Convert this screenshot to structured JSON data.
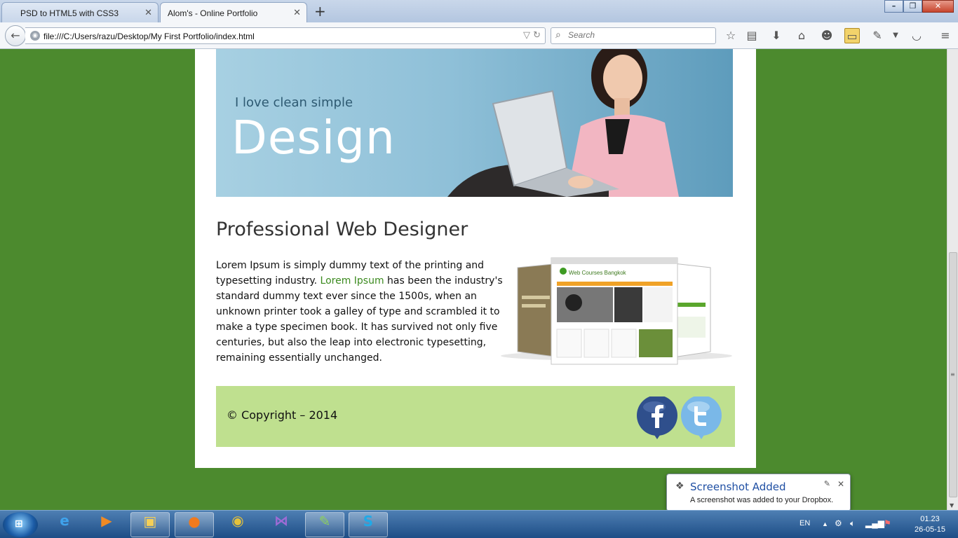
{
  "browser": {
    "tabs": [
      {
        "label": "PSD to HTML5 with CSS3",
        "close": "✕"
      },
      {
        "label": "Alom's - Online Portfolio",
        "close": "✕"
      }
    ],
    "new_tab": "+",
    "url": "file:///C:/Users/razu/Desktop/My First Portfolio/index.html",
    "search_placeholder": "Search",
    "window_buttons": {
      "minimize": "–",
      "maximize": "❐",
      "close": "✕"
    },
    "toolbar_icons": [
      "star-icon",
      "reading-list-icon",
      "download-icon",
      "home-icon",
      "chat-icon",
      "ruler-icon",
      "eyedropper-icon",
      "pocket-icon",
      "menu-icon"
    ]
  },
  "page": {
    "banner": {
      "tagline": "I love clean simple",
      "headline": "Design"
    },
    "heading": "Professional Web Designer",
    "paragraph": {
      "before": "Lorem Ipsum is simply dummy text of the printing and typesetting industry. ",
      "link": "Lorem Ipsum",
      "after": " has been the industry's standard dummy text ever since the 1500s, when an unknown printer took a galley of type and scrambled it to make a type specimen book. It has survived not only five centuries, but also the leap into electronic typesetting, remaining essentially unchanged."
    },
    "mockup": {
      "site_title": "Web Courses Bangkok"
    },
    "footer": {
      "copyright": "© Copyright – 2014"
    },
    "social": [
      "facebook-icon",
      "twitter-icon"
    ],
    "colors": {
      "background": "#4c8a2e",
      "footer": "#bfe08f",
      "link": "#3b8a1e"
    }
  },
  "notification": {
    "title": "Screenshot Added",
    "message": "A screenshot was added to your Dropbox."
  },
  "taskbar": {
    "apps": [
      "internet-explorer",
      "media-player",
      "file-explorer",
      "firefox",
      "chrome",
      "visual-studio",
      "notepad-plus",
      "skype"
    ],
    "language": "EN",
    "time": "01.23",
    "date": "26-05-15"
  }
}
